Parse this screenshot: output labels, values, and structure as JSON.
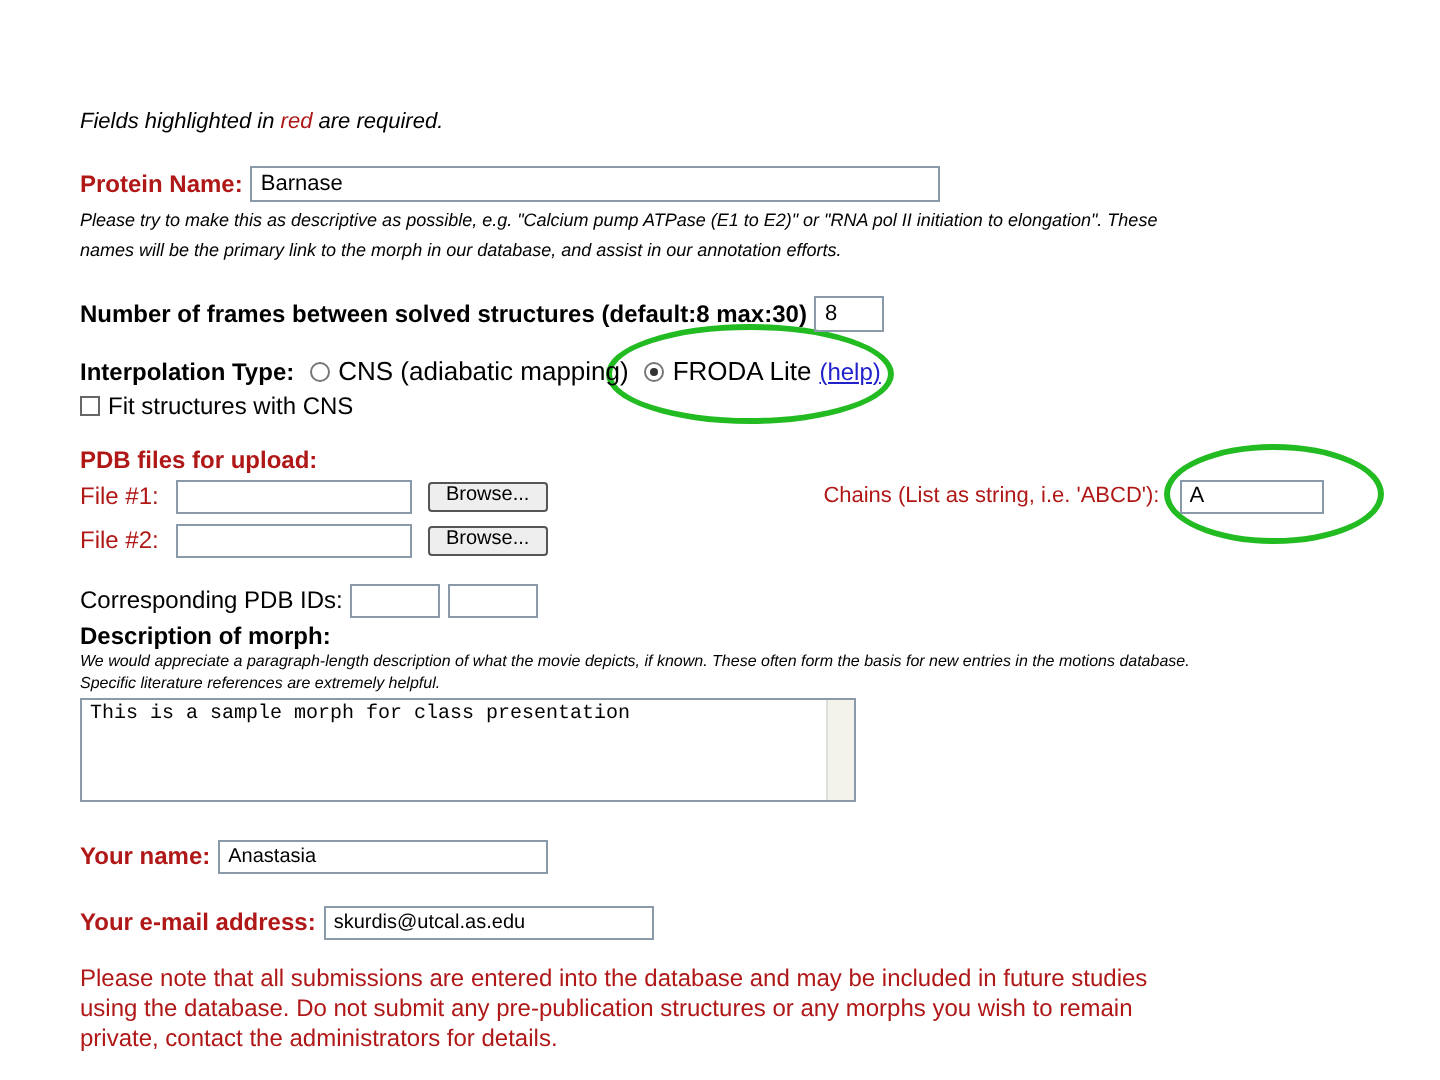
{
  "required_note": {
    "before": "Fields highlighted in ",
    "highlight": "red",
    "after": " are required."
  },
  "protein_name": {
    "label": "Protein Name:",
    "value": "Barnase",
    "hint": "Please try to make this as descriptive as possible, e.g. \"Calcium pump ATPase (E1 to E2)\" or \"RNA pol II initiation to elongation\". These names will be the primary link to the morph in our database, and assist in our annotation efforts."
  },
  "frames": {
    "label": "Number of frames between solved structures (default:8 max:30)",
    "value": "8"
  },
  "interpolation": {
    "label": "Interpolation Type:",
    "options": [
      {
        "label": "CNS (adiabatic mapping)",
        "selected": false
      },
      {
        "label": "FRODA Lite",
        "selected": true
      }
    ],
    "help_link": "(help)"
  },
  "fit_cns": {
    "label": "Fit structures with CNS",
    "checked": false
  },
  "pdb_files": {
    "heading": "PDB files for upload:",
    "files": [
      {
        "label": "File #1:",
        "button": "Browse..."
      },
      {
        "label": "File #2:",
        "button": "Browse..."
      }
    ],
    "chains": {
      "label": "Chains (List as string, i.e. 'ABCD'):",
      "value": "A"
    }
  },
  "pdb_ids": {
    "label": "Corresponding PDB IDs:"
  },
  "description": {
    "label": "Description of morph:",
    "hint": "We would appreciate a paragraph-length description of what the movie depicts, if known. These often form the basis for new entries in the motions database. Specific literature references are extremely helpful.",
    "value": "This is a sample morph for class presentation"
  },
  "your_name": {
    "label": "Your name:",
    "value": "Anastasia"
  },
  "email": {
    "label": "Your e-mail address:",
    "value": "skurdis@utcal.as.edu"
  },
  "footer_note": "Please note that all submissions are entered into the database and may be included in future studies using the database. Do not submit any pre-publication structures or any morphs you wish to remain private, contact the administrators for details.",
  "annotations": [
    {
      "kind": "ellipse"
    },
    {
      "kind": "ellipse"
    }
  ]
}
